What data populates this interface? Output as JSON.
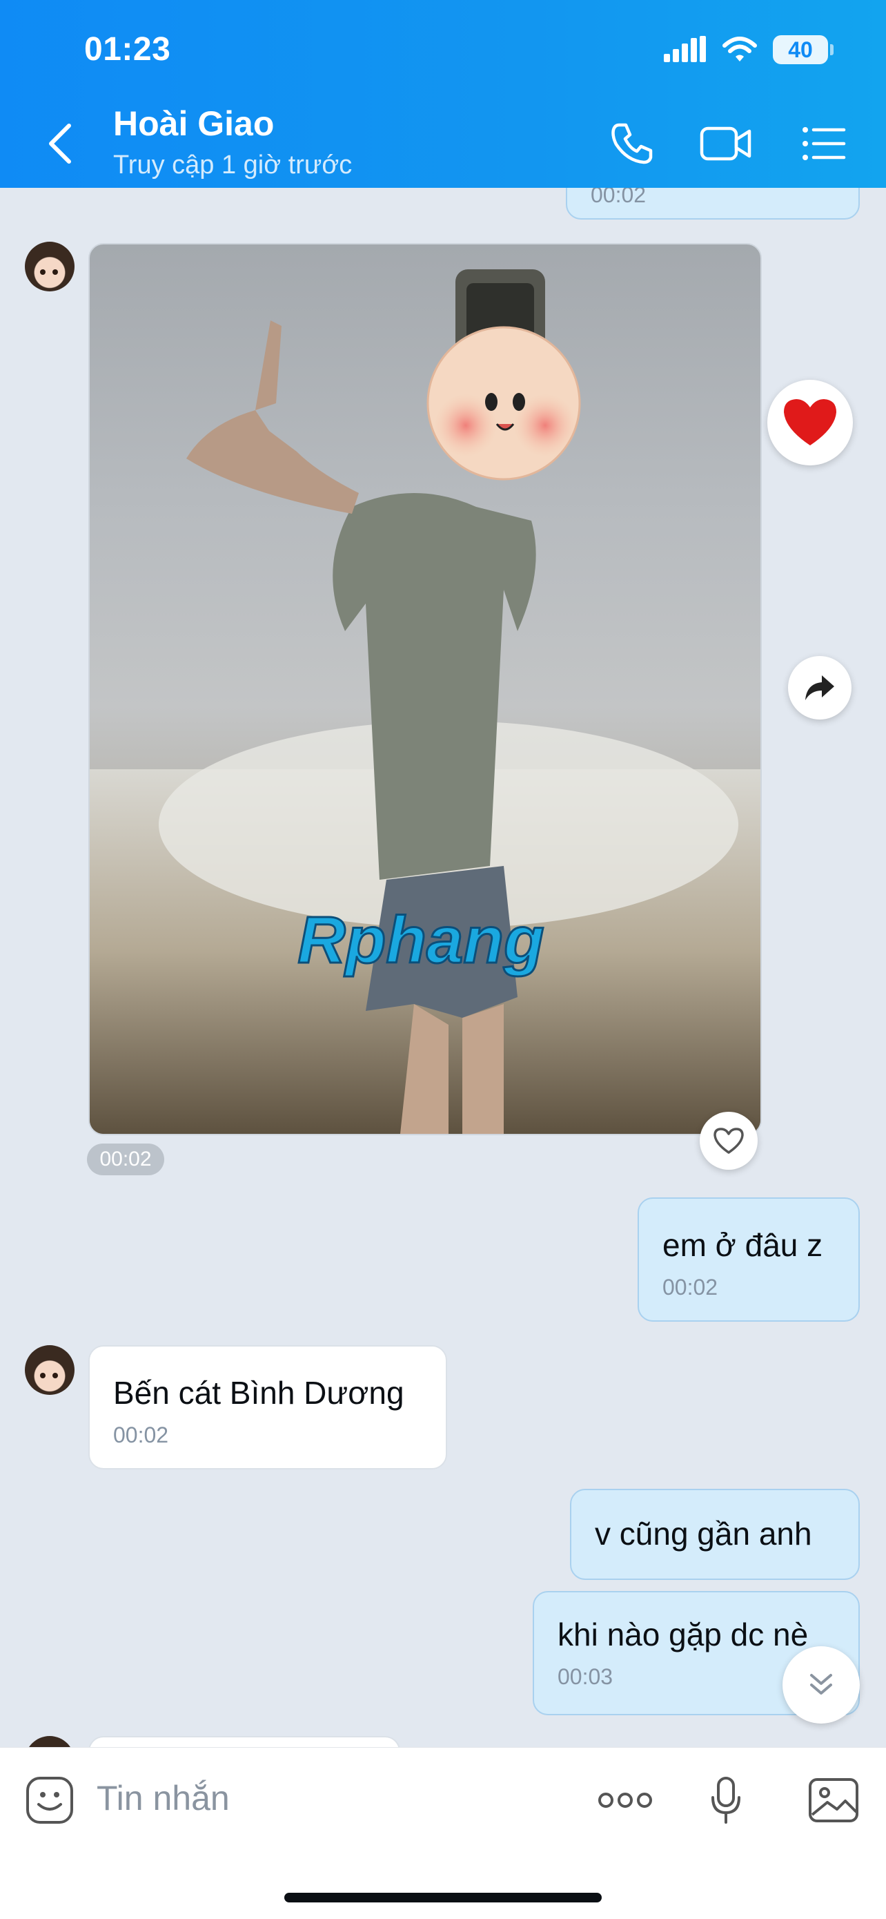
{
  "status_bar": {
    "time": "01:23",
    "battery": "40"
  },
  "header": {
    "contact_name": "Hoài Giao",
    "contact_status": "Truy cập 1 giờ trước"
  },
  "messages": [
    {
      "dir": "out",
      "text": "",
      "time": "00:02"
    },
    {
      "dir": "in",
      "type": "photo",
      "watermark": "Rphang",
      "time": "00:02"
    },
    {
      "dir": "out",
      "text": "em ở đâu z",
      "time": "00:02"
    },
    {
      "dir": "in",
      "text": "Bến cát Bình Dương",
      "time": "00:02"
    },
    {
      "dir": "out",
      "text": "v cũng gần anh",
      "time": ""
    },
    {
      "dir": "out",
      "text": "khi nào gặp dc nè",
      "time": "00:03"
    }
  ],
  "composer": {
    "placeholder": "Tin nhắn"
  },
  "icons": {
    "back": "chevron-left-icon",
    "call": "phone-icon",
    "video": "video-camera-icon",
    "menu": "list-menu-icon",
    "reaction": "heart-icon",
    "forward": "share-arrow-icon",
    "scroll": "double-chevron-down-icon",
    "sticker": "sticker-face-icon",
    "more": "more-dots-icon",
    "voice": "microphone-icon",
    "gallery": "image-icon"
  },
  "colors": {
    "header": "#0f8bf5",
    "outgoing_bubble": "#d4ecfb",
    "incoming_bubble": "#ffffff",
    "background": "#e2e8f0"
  }
}
